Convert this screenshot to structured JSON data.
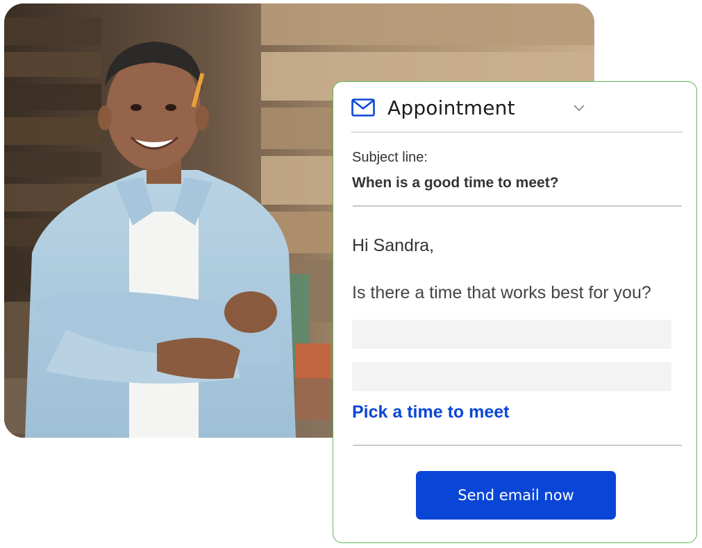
{
  "email_card": {
    "title": "Appointment",
    "icon": "mail-icon",
    "dropdown_icon": "chevron-down-icon",
    "subject_label": "Subject line:",
    "subject_value": "When is a good time to meet?",
    "greeting": "Hi Sandra,",
    "body_question": "Is there a time that works best for you?",
    "link_label": "Pick a time to meet",
    "button_label": "Send email now"
  },
  "colors": {
    "accent": "#0a46d6",
    "card_border": "#5cb85c",
    "placeholder": "#f3f3f3"
  }
}
